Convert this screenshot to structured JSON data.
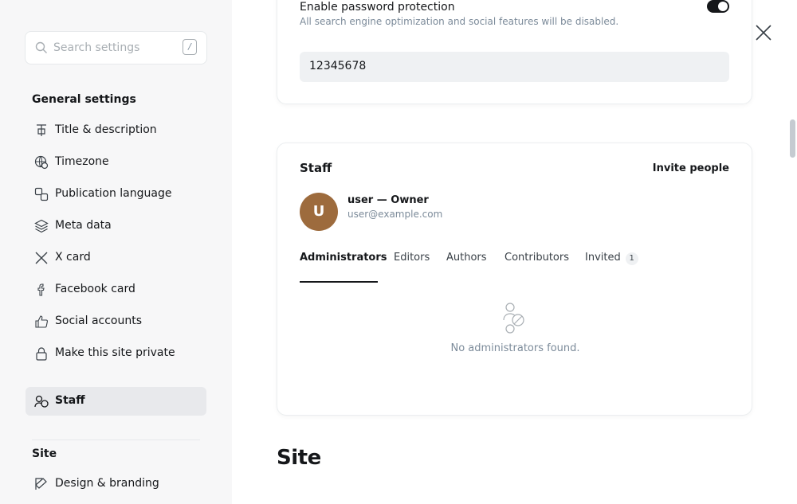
{
  "sidebar": {
    "search": {
      "placeholder": "Search settings",
      "shortcut": "/"
    },
    "general_title": "General settings",
    "items": [
      {
        "label": "Title & description",
        "icon": "title-icon"
      },
      {
        "label": "Timezone",
        "icon": "globe-clock-icon"
      },
      {
        "label": "Publication language",
        "icon": "translate-icon"
      },
      {
        "label": "Meta data",
        "icon": "layers-icon"
      },
      {
        "label": "X card",
        "icon": "x-logo-icon"
      },
      {
        "label": "Facebook card",
        "icon": "facebook-icon"
      },
      {
        "label": "Social accounts",
        "icon": "thumbs-up-icon"
      },
      {
        "label": "Make this site private",
        "icon": "lock-icon"
      },
      {
        "label": "Staff",
        "icon": "staff-icon",
        "active": true
      }
    ],
    "site_title": "Site",
    "site_items": [
      {
        "label": "Design & branding",
        "icon": "brush-icon"
      }
    ]
  },
  "password_protection": {
    "title": "Enable password protection",
    "description": "All search engine optimization and social features will be disabled.",
    "enabled": true,
    "password": "12345678"
  },
  "staff": {
    "title": "Staff",
    "invite_label": "Invite people",
    "user": {
      "initial": "U",
      "name": "user",
      "role": "Owner",
      "email": "user@example.com"
    },
    "tabs": [
      {
        "label": "Administrators",
        "active": true
      },
      {
        "label": "Editors"
      },
      {
        "label": "Authors"
      },
      {
        "label": "Contributors"
      },
      {
        "label": "Invited",
        "count": "1"
      }
    ],
    "empty_text": "No administrators found."
  },
  "site_heading": "Site",
  "colors": {
    "text": "#15171a",
    "muted": "#7c8b9a",
    "active_bg": "#e8e9ec",
    "avatar_bg": "#9d6b3d"
  }
}
